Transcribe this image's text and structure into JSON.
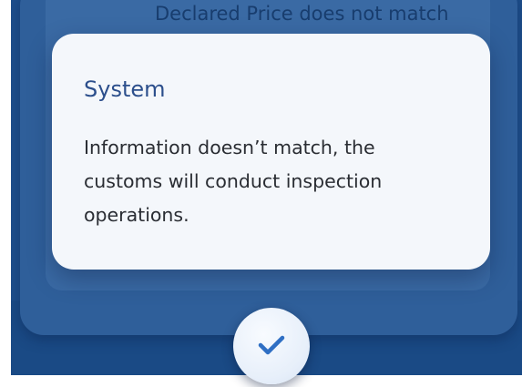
{
  "background": {
    "partial_text": "Declared Price does not match"
  },
  "dialog": {
    "title": "System",
    "message": "Information doesn’t match, the customs will conduct inspection operations."
  },
  "confirm": {
    "icon": "checkmark-icon"
  },
  "colors": {
    "backdrop": "#1e4f8c",
    "panel": "#2f5f9a",
    "dialog_bg": "#f4f7fb",
    "title_color": "#2c4f8c",
    "check_color": "#2f6fc4"
  }
}
